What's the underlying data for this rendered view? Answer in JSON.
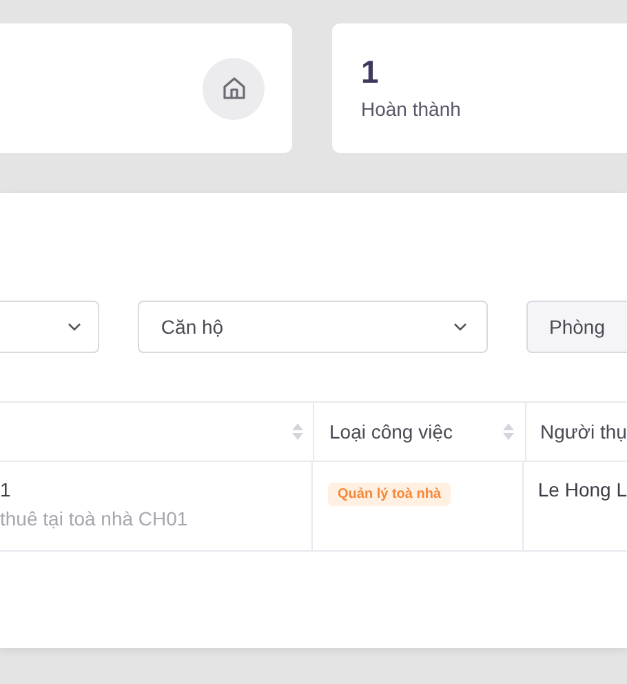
{
  "stat_cards": [
    {
      "kind": "icon"
    },
    {
      "kind": "value",
      "value": "1",
      "label": "Hoàn thành"
    }
  ],
  "filters": [
    {
      "disabled": false
    },
    {
      "value": "Căn hộ",
      "disabled": false
    },
    {
      "value": "Phòng",
      "disabled": true
    }
  ],
  "table": {
    "columns": [
      {
        "sortable": true
      },
      {
        "label": "Loại công việc",
        "sortable": true
      },
      {
        "label": "Người thụ"
      }
    ],
    "rows": [
      {
        "title": "1",
        "subtitle": "thuê tại toà nhà CH01",
        "tag": "Quản lý toà nhà",
        "assignee": "Le Hong L"
      }
    ]
  }
}
